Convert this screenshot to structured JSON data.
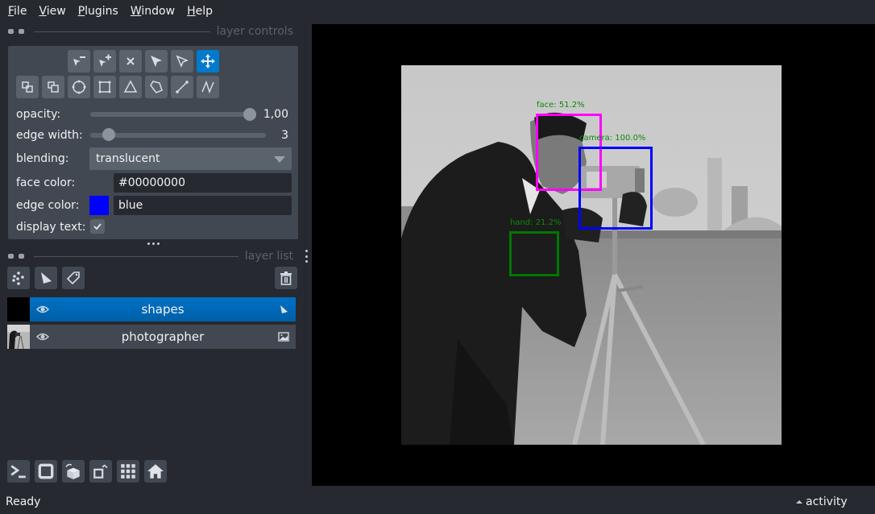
{
  "menu": [
    {
      "label": "File",
      "mnemonic": "F",
      "rest": "ile"
    },
    {
      "label": "View",
      "mnemonic": "V",
      "rest": "iew"
    },
    {
      "label": "Plugins",
      "mnemonic": "P",
      "rest": "lugins"
    },
    {
      "label": "Window",
      "mnemonic": "W",
      "rest": "indow"
    },
    {
      "label": "Help",
      "mnemonic": "H",
      "rest": "elp"
    }
  ],
  "layer_controls": {
    "title": "layer controls",
    "toolbar_row1": [
      "remove-point-icon",
      "add-point-icon",
      "delete-shape-icon",
      "select-shape-icon",
      "direct-select-icon",
      "pan-zoom-icon"
    ],
    "toolbar_row2": [
      "move-back-icon",
      "move-front-icon",
      "ellipse-icon",
      "rectangle-icon",
      "polygon-triangle-icon",
      "polygon-icon",
      "line-icon",
      "path-icon"
    ],
    "active_tool": "pan-zoom-icon",
    "opacity": {
      "label": "opacity:",
      "value": 1.0,
      "display": "1,00"
    },
    "edge_width": {
      "label": "edge width:",
      "value": 3,
      "display": "3",
      "min": 0,
      "max": 40
    },
    "blending": {
      "label": "blending:",
      "value": "translucent"
    },
    "face_color": {
      "label": "face color:",
      "value": "#00000000"
    },
    "edge_color": {
      "label": "edge color:",
      "value": "blue",
      "swatch": "#0000ff"
    },
    "display_text": {
      "label": "display text:",
      "checked": true
    }
  },
  "layer_list": {
    "title": "layer list",
    "buttons": [
      "new-points-layer-button",
      "new-shapes-layer-button",
      "new-labels-layer-button",
      "delete-layer-button"
    ],
    "layers": [
      {
        "name": "shapes",
        "type": "shapes",
        "visible": true,
        "selected": true
      },
      {
        "name": "photographer",
        "type": "image",
        "visible": true,
        "selected": false
      }
    ]
  },
  "bottom_buttons": [
    "console-icon",
    "ndisplay-square-icon",
    "roll-dims-icon",
    "transpose-icon",
    "grid-icon",
    "home-icon"
  ],
  "canvas": {
    "annotations": [
      {
        "label": "face: 51.2%",
        "color": "#ff00ff"
      },
      {
        "label": "camera: 100.0%",
        "color": "#0000ff"
      },
      {
        "label": "hand: 21.2%",
        "color": "#007700"
      }
    ]
  },
  "status": {
    "text": "Ready",
    "activity": "activity"
  }
}
